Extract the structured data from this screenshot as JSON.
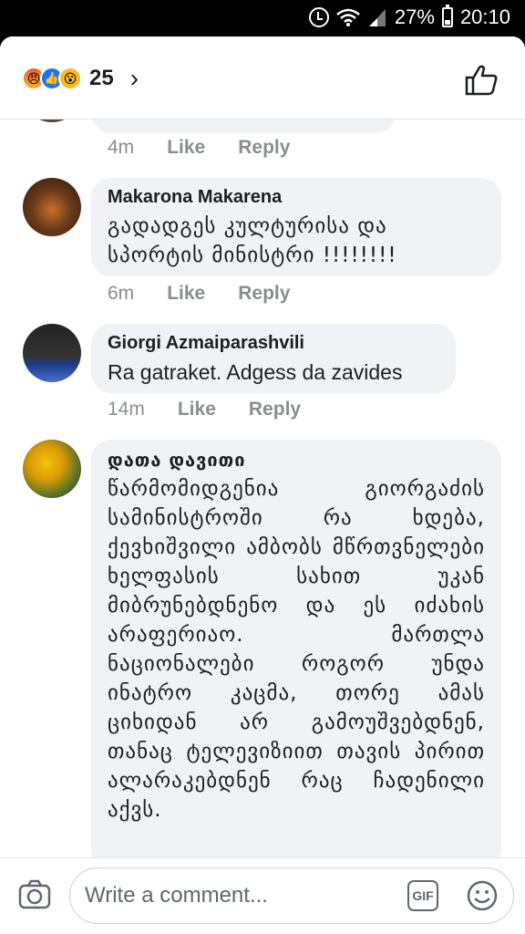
{
  "status_bar": {
    "battery": "27%",
    "time": "20:10"
  },
  "reactions": {
    "count": "25",
    "icons": [
      "angry-icon",
      "like-icon",
      "wow-icon"
    ]
  },
  "comments": [
    {
      "author": "",
      "text": "",
      "time": "4m",
      "like": "Like",
      "reply": "Reply"
    },
    {
      "author": "Makarona Makarena",
      "text": "გადადგეს კულტურისა და სპორტის მინისტრი !!!!!!!!",
      "time": "6m",
      "like": "Like",
      "reply": "Reply"
    },
    {
      "author": "Giorgi Azmaiparashvili",
      "text": "Ra gatraket. Adgess da zavides",
      "time": "14m",
      "like": "Like",
      "reply": "Reply"
    },
    {
      "author": "დათა დავითი",
      "text": "წარმომიდგენია გიორგაძის სამინისტროში რა ხდება, ქევხიშვილი ამბობს მწრთვნელები ხელფასის სახით უკან მიბრუნებდნენო და ეს იძახის არაფერიაო. მართლა ნაციონალები როგორ უნდა ინატრო კაცმა, თორე ამას ციხიდან არ გამოუშვებდნენ, თანაც ტელევიზიით თავის პირით ალარაკებდნენ რაც ჩადენილი აქვს.",
      "time": "",
      "like": "",
      "reply": ""
    }
  ],
  "composer": {
    "placeholder": "Write a comment...",
    "gif_label": "GIF"
  }
}
